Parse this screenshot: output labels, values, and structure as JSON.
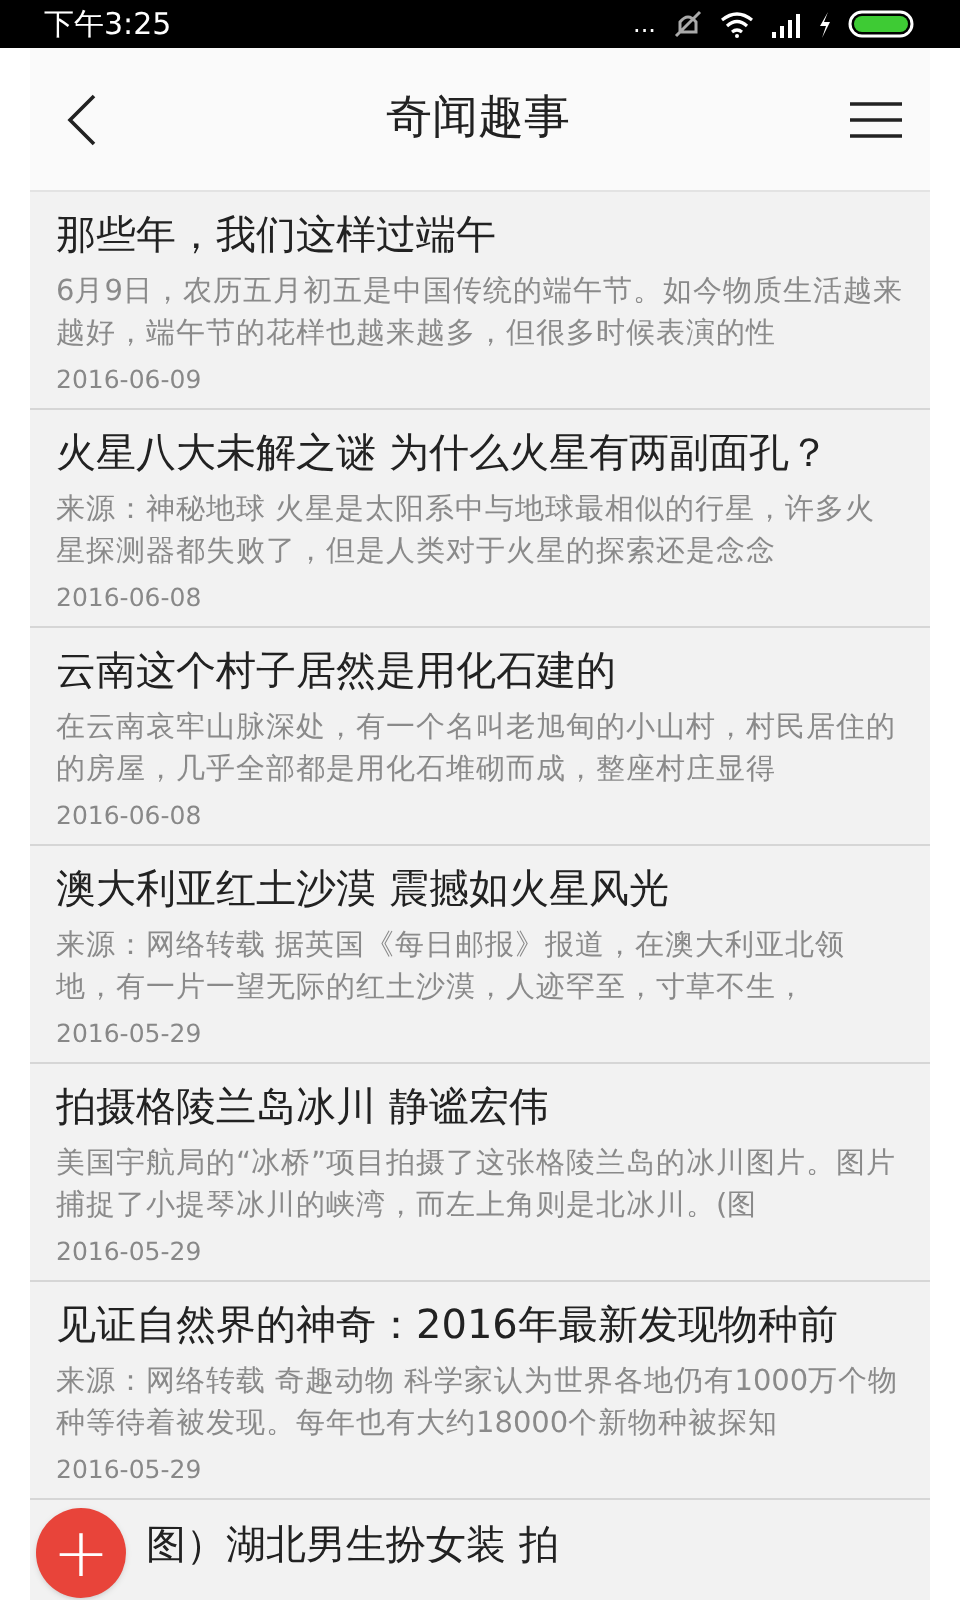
{
  "status_bar": {
    "time": "下午3:25",
    "dots": "..."
  },
  "header": {
    "title": "奇闻趣事"
  },
  "articles": [
    {
      "kind": "full",
      "title": "那些年，我们这样过端午",
      "summary": "6月9日，农历五月初五是中国传统的端午节。如今物质生活越来越好，端午节的花样也越来越多，但很多时候表演的性",
      "date": "2016-06-09"
    },
    {
      "kind": "full",
      "title": "火星八大未解之谜 为什么火星有两副面孔？",
      "summary": "来源：神秘地球  火星是太阳系中与地球最相似的行星，许多火星探测器都失败了，但是人类对于火星的探索还是念念",
      "date": "2016-06-08"
    },
    {
      "kind": "full",
      "title": "云南这个村子居然是用化石建的",
      "summary": "在云南哀牢山脉深处，有一个名叫老旭甸的小山村，村民居住的的房屋，几乎全部都是用化石堆砌而成，整座村庄显得",
      "date": "2016-06-08"
    },
    {
      "kind": "full",
      "title": "澳大利亚红土沙漠 震撼如火星风光",
      "summary": "来源：网络转载  据英国《每日邮报》报道，在澳大利亚北领地，有一片一望无际的红土沙漠，人迹罕至，寸草不生，",
      "date": "2016-05-29"
    },
    {
      "kind": "full",
      "title": "拍摄格陵兰岛冰川 静谧宏伟",
      "summary": "美国宇航局的“冰桥”项目拍摄了这张格陵兰岛的冰川图片。图片捕捉了小提琴冰川的峡湾，而左上角则是北冰川。(图",
      "date": "2016-05-29"
    },
    {
      "kind": "full",
      "title": "见证自然界的神奇：2016年最新发现物种前",
      "summary": "来源：网络转载 奇趣动物 科学家认为世界各地仍有1000万个物种等待着被发现。每年也有大约18000个新物种被探知",
      "date": "2016-05-29"
    },
    {
      "kind": "partial",
      "title": "图）湖北男生扮女装 拍"
    }
  ],
  "fab": {
    "label": "+"
  }
}
